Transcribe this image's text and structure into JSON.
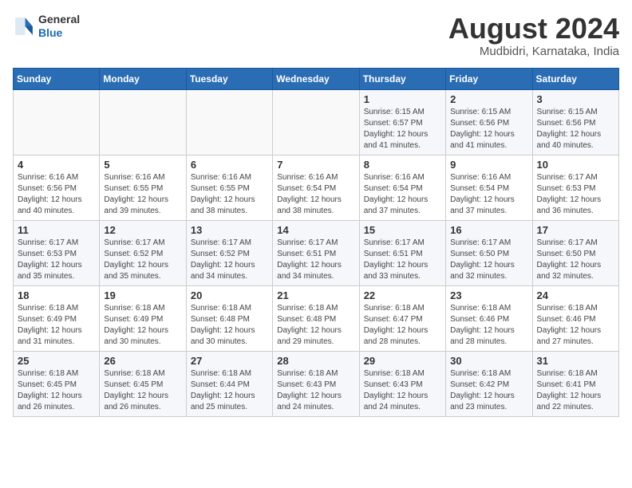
{
  "header": {
    "logo_general": "General",
    "logo_blue": "Blue",
    "title": "August 2024",
    "subtitle": "Mudbidri, Karnataka, India"
  },
  "days_of_week": [
    "Sunday",
    "Monday",
    "Tuesday",
    "Wednesday",
    "Thursday",
    "Friday",
    "Saturday"
  ],
  "weeks": [
    [
      {
        "day": "",
        "info": ""
      },
      {
        "day": "",
        "info": ""
      },
      {
        "day": "",
        "info": ""
      },
      {
        "day": "",
        "info": ""
      },
      {
        "day": "1",
        "info": "Sunrise: 6:15 AM\nSunset: 6:57 PM\nDaylight: 12 hours\nand 41 minutes."
      },
      {
        "day": "2",
        "info": "Sunrise: 6:15 AM\nSunset: 6:56 PM\nDaylight: 12 hours\nand 41 minutes."
      },
      {
        "day": "3",
        "info": "Sunrise: 6:15 AM\nSunset: 6:56 PM\nDaylight: 12 hours\nand 40 minutes."
      }
    ],
    [
      {
        "day": "4",
        "info": "Sunrise: 6:16 AM\nSunset: 6:56 PM\nDaylight: 12 hours\nand 40 minutes."
      },
      {
        "day": "5",
        "info": "Sunrise: 6:16 AM\nSunset: 6:55 PM\nDaylight: 12 hours\nand 39 minutes."
      },
      {
        "day": "6",
        "info": "Sunrise: 6:16 AM\nSunset: 6:55 PM\nDaylight: 12 hours\nand 38 minutes."
      },
      {
        "day": "7",
        "info": "Sunrise: 6:16 AM\nSunset: 6:54 PM\nDaylight: 12 hours\nand 38 minutes."
      },
      {
        "day": "8",
        "info": "Sunrise: 6:16 AM\nSunset: 6:54 PM\nDaylight: 12 hours\nand 37 minutes."
      },
      {
        "day": "9",
        "info": "Sunrise: 6:16 AM\nSunset: 6:54 PM\nDaylight: 12 hours\nand 37 minutes."
      },
      {
        "day": "10",
        "info": "Sunrise: 6:17 AM\nSunset: 6:53 PM\nDaylight: 12 hours\nand 36 minutes."
      }
    ],
    [
      {
        "day": "11",
        "info": "Sunrise: 6:17 AM\nSunset: 6:53 PM\nDaylight: 12 hours\nand 35 minutes."
      },
      {
        "day": "12",
        "info": "Sunrise: 6:17 AM\nSunset: 6:52 PM\nDaylight: 12 hours\nand 35 minutes."
      },
      {
        "day": "13",
        "info": "Sunrise: 6:17 AM\nSunset: 6:52 PM\nDaylight: 12 hours\nand 34 minutes."
      },
      {
        "day": "14",
        "info": "Sunrise: 6:17 AM\nSunset: 6:51 PM\nDaylight: 12 hours\nand 34 minutes."
      },
      {
        "day": "15",
        "info": "Sunrise: 6:17 AM\nSunset: 6:51 PM\nDaylight: 12 hours\nand 33 minutes."
      },
      {
        "day": "16",
        "info": "Sunrise: 6:17 AM\nSunset: 6:50 PM\nDaylight: 12 hours\nand 32 minutes."
      },
      {
        "day": "17",
        "info": "Sunrise: 6:17 AM\nSunset: 6:50 PM\nDaylight: 12 hours\nand 32 minutes."
      }
    ],
    [
      {
        "day": "18",
        "info": "Sunrise: 6:18 AM\nSunset: 6:49 PM\nDaylight: 12 hours\nand 31 minutes."
      },
      {
        "day": "19",
        "info": "Sunrise: 6:18 AM\nSunset: 6:49 PM\nDaylight: 12 hours\nand 30 minutes."
      },
      {
        "day": "20",
        "info": "Sunrise: 6:18 AM\nSunset: 6:48 PM\nDaylight: 12 hours\nand 30 minutes."
      },
      {
        "day": "21",
        "info": "Sunrise: 6:18 AM\nSunset: 6:48 PM\nDaylight: 12 hours\nand 29 minutes."
      },
      {
        "day": "22",
        "info": "Sunrise: 6:18 AM\nSunset: 6:47 PM\nDaylight: 12 hours\nand 28 minutes."
      },
      {
        "day": "23",
        "info": "Sunrise: 6:18 AM\nSunset: 6:46 PM\nDaylight: 12 hours\nand 28 minutes."
      },
      {
        "day": "24",
        "info": "Sunrise: 6:18 AM\nSunset: 6:46 PM\nDaylight: 12 hours\nand 27 minutes."
      }
    ],
    [
      {
        "day": "25",
        "info": "Sunrise: 6:18 AM\nSunset: 6:45 PM\nDaylight: 12 hours\nand 26 minutes."
      },
      {
        "day": "26",
        "info": "Sunrise: 6:18 AM\nSunset: 6:45 PM\nDaylight: 12 hours\nand 26 minutes."
      },
      {
        "day": "27",
        "info": "Sunrise: 6:18 AM\nSunset: 6:44 PM\nDaylight: 12 hours\nand 25 minutes."
      },
      {
        "day": "28",
        "info": "Sunrise: 6:18 AM\nSunset: 6:43 PM\nDaylight: 12 hours\nand 24 minutes."
      },
      {
        "day": "29",
        "info": "Sunrise: 6:18 AM\nSunset: 6:43 PM\nDaylight: 12 hours\nand 24 minutes."
      },
      {
        "day": "30",
        "info": "Sunrise: 6:18 AM\nSunset: 6:42 PM\nDaylight: 12 hours\nand 23 minutes."
      },
      {
        "day": "31",
        "info": "Sunrise: 6:18 AM\nSunset: 6:41 PM\nDaylight: 12 hours\nand 22 minutes."
      }
    ]
  ]
}
